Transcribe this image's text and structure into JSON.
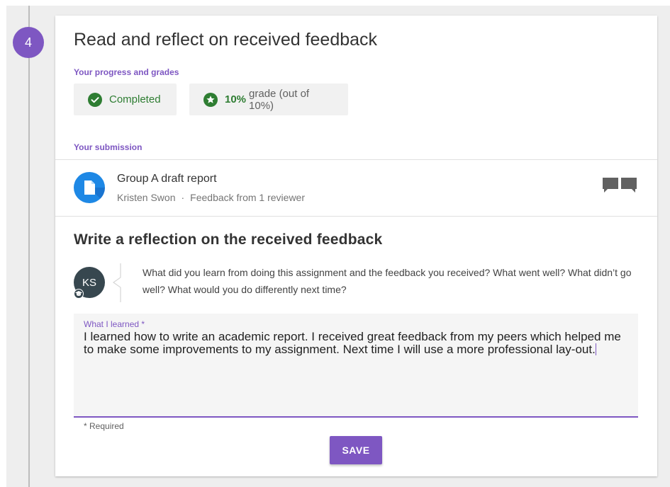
{
  "step": {
    "number": "4"
  },
  "card": {
    "title": "Read and reflect on received feedback",
    "progress_label": "Your progress and grades",
    "status": {
      "label": "Completed",
      "icon": "check-circle-icon",
      "color": "#2e7d32"
    },
    "grade": {
      "value": "10%",
      "suffix": "grade (out of 10%)",
      "icon": "star-circle-icon"
    },
    "submission_label": "Your submission"
  },
  "submission": {
    "title": "Group A draft report",
    "author": "Kristen Swon",
    "separator": "·",
    "feedback": "Feedback from 1 reviewer",
    "icon": "document-icon",
    "action_icon": "comments-icon"
  },
  "reflection": {
    "title": "Write a reflection on the received feedback",
    "avatar_initials": "KS",
    "prompt": "What did you learn from doing this assignment and the feedback you received? What went well? What didn’t go well? What would you do differently next time?",
    "field_label": "What I learned *",
    "field_value": "I learned how to write an academic report. I received great feedback from my peers which helped me to make some improvements to my assignment. Next time I will use a more professional lay-out.",
    "required_note": "* Required",
    "save_label": "SAVE"
  },
  "colors": {
    "accent": "#7e57c2",
    "success": "#2e7d32",
    "doc_blue": "#1e88e5",
    "avatar_bg": "#37474f"
  }
}
